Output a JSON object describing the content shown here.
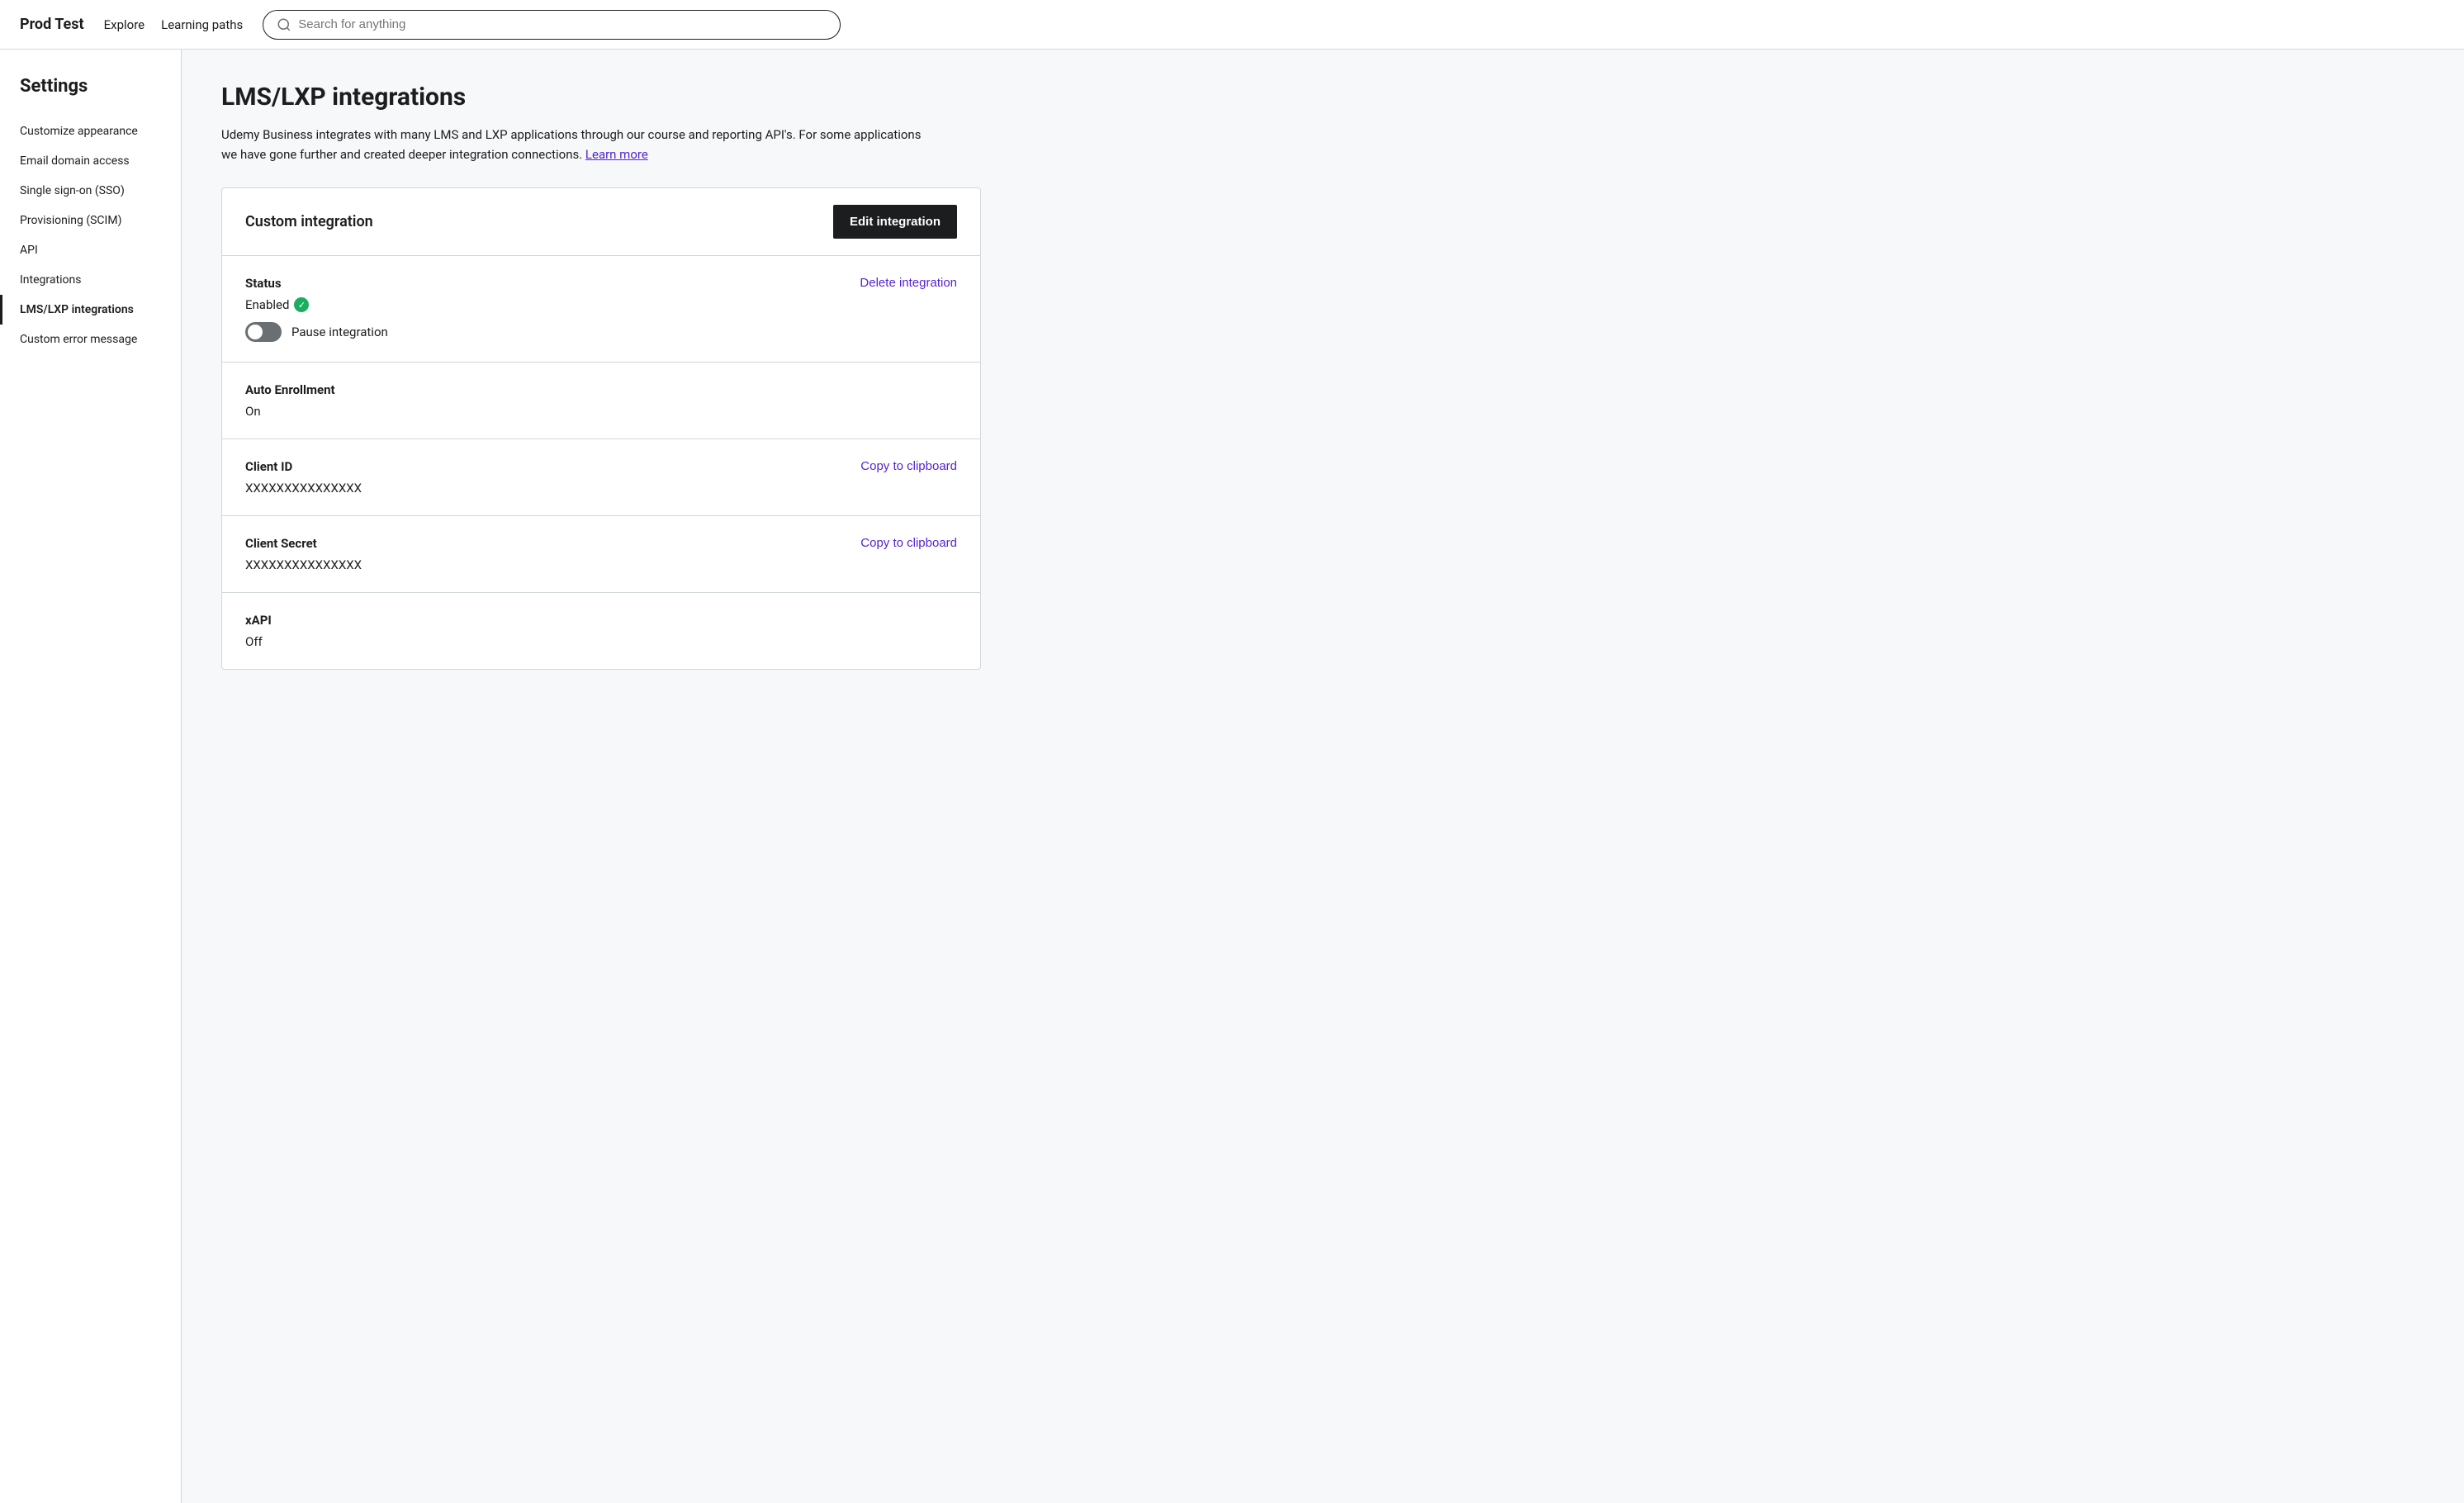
{
  "topnav": {
    "brand": "Prod Test",
    "links": [
      "Explore",
      "Learning paths"
    ],
    "search_placeholder": "Search for anything"
  },
  "sidebar": {
    "title": "Settings",
    "items": [
      {
        "id": "customize-appearance",
        "label": "Customize appearance",
        "active": false
      },
      {
        "id": "email-domain-access",
        "label": "Email domain access",
        "active": false
      },
      {
        "id": "single-sign-on",
        "label": "Single sign-on (SSO)",
        "active": false
      },
      {
        "id": "provisioning-scim",
        "label": "Provisioning (SCIM)",
        "active": false
      },
      {
        "id": "api",
        "label": "API",
        "active": false
      },
      {
        "id": "integrations",
        "label": "Integrations",
        "active": false
      },
      {
        "id": "lms-lxp-integrations",
        "label": "LMS/LXP integrations",
        "active": true
      },
      {
        "id": "custom-error-message",
        "label": "Custom error message",
        "active": false
      }
    ]
  },
  "page": {
    "title": "LMS/LXP integrations",
    "description": "Udemy Business integrates with many LMS and LXP applications through our course and reporting API's. For some applications we have gone further and created deeper integration connections.",
    "learn_more_label": "Learn more"
  },
  "card": {
    "header_title": "Custom integration",
    "edit_button_label": "Edit integration",
    "sections": [
      {
        "id": "status",
        "label": "Status",
        "enabled_label": "Enabled",
        "toggle_label": "Pause integration",
        "delete_link": "Delete integration"
      },
      {
        "id": "auto-enrollment",
        "label": "Auto Enrollment",
        "value": "On"
      },
      {
        "id": "client-id",
        "label": "Client ID",
        "value": "XXXXXXXXXXXXXXX",
        "copy_link": "Copy to clipboard"
      },
      {
        "id": "client-secret",
        "label": "Client Secret",
        "value": "XXXXXXXXXXXXXXX",
        "copy_link": "Copy to clipboard"
      },
      {
        "id": "xapi",
        "label": "xAPI",
        "value": "Off"
      }
    ]
  }
}
